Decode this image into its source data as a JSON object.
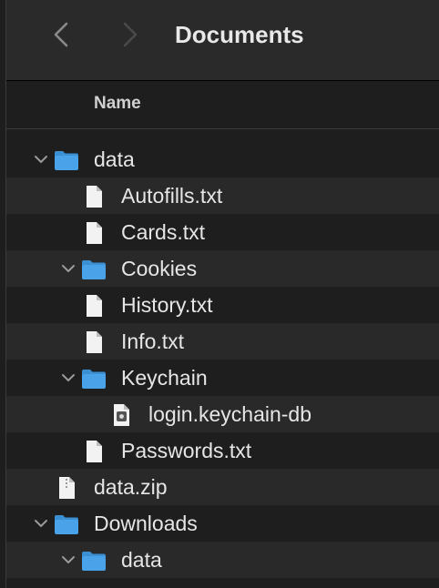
{
  "window": {
    "title": "Documents"
  },
  "columns": {
    "name": "Name"
  },
  "icons": {
    "back": "chevron-left-icon",
    "forward": "chevron-right-icon",
    "folder": "folder-icon",
    "file": "document-icon",
    "keychain": "keychain-file-icon",
    "zip": "zip-file-icon"
  },
  "colors": {
    "folder": "#4aa3e8",
    "file": "#f2f2f2"
  },
  "rows": [
    {
      "label": "data",
      "kind": "folder",
      "level": 0,
      "expanded": true
    },
    {
      "label": "Autofills.txt",
      "kind": "file",
      "level": 1
    },
    {
      "label": "Cards.txt",
      "kind": "file",
      "level": 1
    },
    {
      "label": "Cookies",
      "kind": "folder",
      "level": 1,
      "expanded": true
    },
    {
      "label": "History.txt",
      "kind": "file",
      "level": 1
    },
    {
      "label": "Info.txt",
      "kind": "file",
      "level": 1
    },
    {
      "label": "Keychain",
      "kind": "folder",
      "level": 1,
      "expanded": true
    },
    {
      "label": "login.keychain-db",
      "kind": "keychain",
      "level": 2
    },
    {
      "label": "Passwords.txt",
      "kind": "file",
      "level": 1
    },
    {
      "label": "data.zip",
      "kind": "zip",
      "level": 0
    },
    {
      "label": "Downloads",
      "kind": "folder",
      "level": 0,
      "expanded": true
    },
    {
      "label": "data",
      "kind": "folder",
      "level": 1,
      "expanded": true
    }
  ]
}
